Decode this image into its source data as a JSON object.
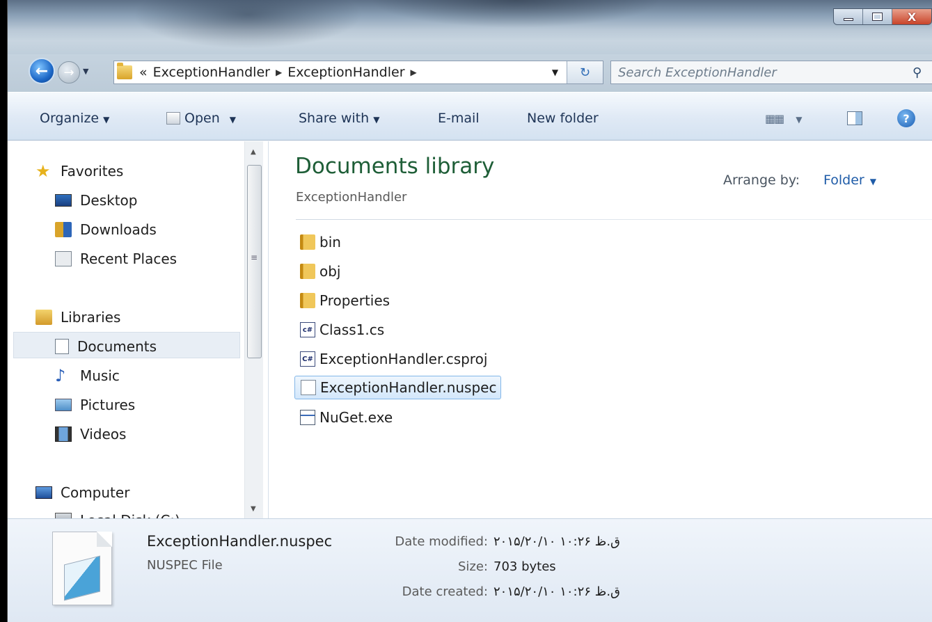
{
  "window": {
    "controls": {
      "minimize": "minimize",
      "maximize": "maximize",
      "close": "X"
    }
  },
  "address": {
    "prefix": "«",
    "crumbs": [
      "ExceptionHandler",
      "ExceptionHandler"
    ]
  },
  "search": {
    "placeholder": "Search ExceptionHandler"
  },
  "toolbar": {
    "organize": "Organize",
    "open": "Open",
    "share_with": "Share with",
    "email": "E-mail",
    "new_folder": "New folder"
  },
  "navpane": {
    "favorites": "Favorites",
    "desktop": "Desktop",
    "downloads": "Downloads",
    "recent": "Recent Places",
    "libraries": "Libraries",
    "documents": "Documents",
    "music": "Music",
    "pictures": "Pictures",
    "videos": "Videos",
    "computer": "Computer",
    "local_disk": "Local Disk (C:)"
  },
  "content": {
    "title": "Documents library",
    "subtitle": "ExceptionHandler",
    "arrange_label": "Arrange by:",
    "arrange_value": "Folder",
    "files": [
      {
        "name": "bin",
        "kind": "folder"
      },
      {
        "name": "obj",
        "kind": "folder"
      },
      {
        "name": "Properties",
        "kind": "folder"
      },
      {
        "name": "Class1.cs",
        "kind": "cs"
      },
      {
        "name": "ExceptionHandler.csproj",
        "kind": "csproj"
      },
      {
        "name": "ExceptionHandler.nuspec",
        "kind": "nuspec"
      },
      {
        "name": "NuGet.exe",
        "kind": "exe"
      }
    ]
  },
  "details": {
    "name": "ExceptionHandler.nuspec",
    "type": "NUSPEC File",
    "modified_label": "Date modified:",
    "modified_value": "۲۰۱۵/۲۰/۱۰ ق.ظ ۱۰:۲۶",
    "size_label": "Size:",
    "size_value": "703 bytes",
    "created_label": "Date created:",
    "created_value": "۲۰۱۵/۲۰/۱۰ ق.ظ ۱۰:۲۶"
  }
}
